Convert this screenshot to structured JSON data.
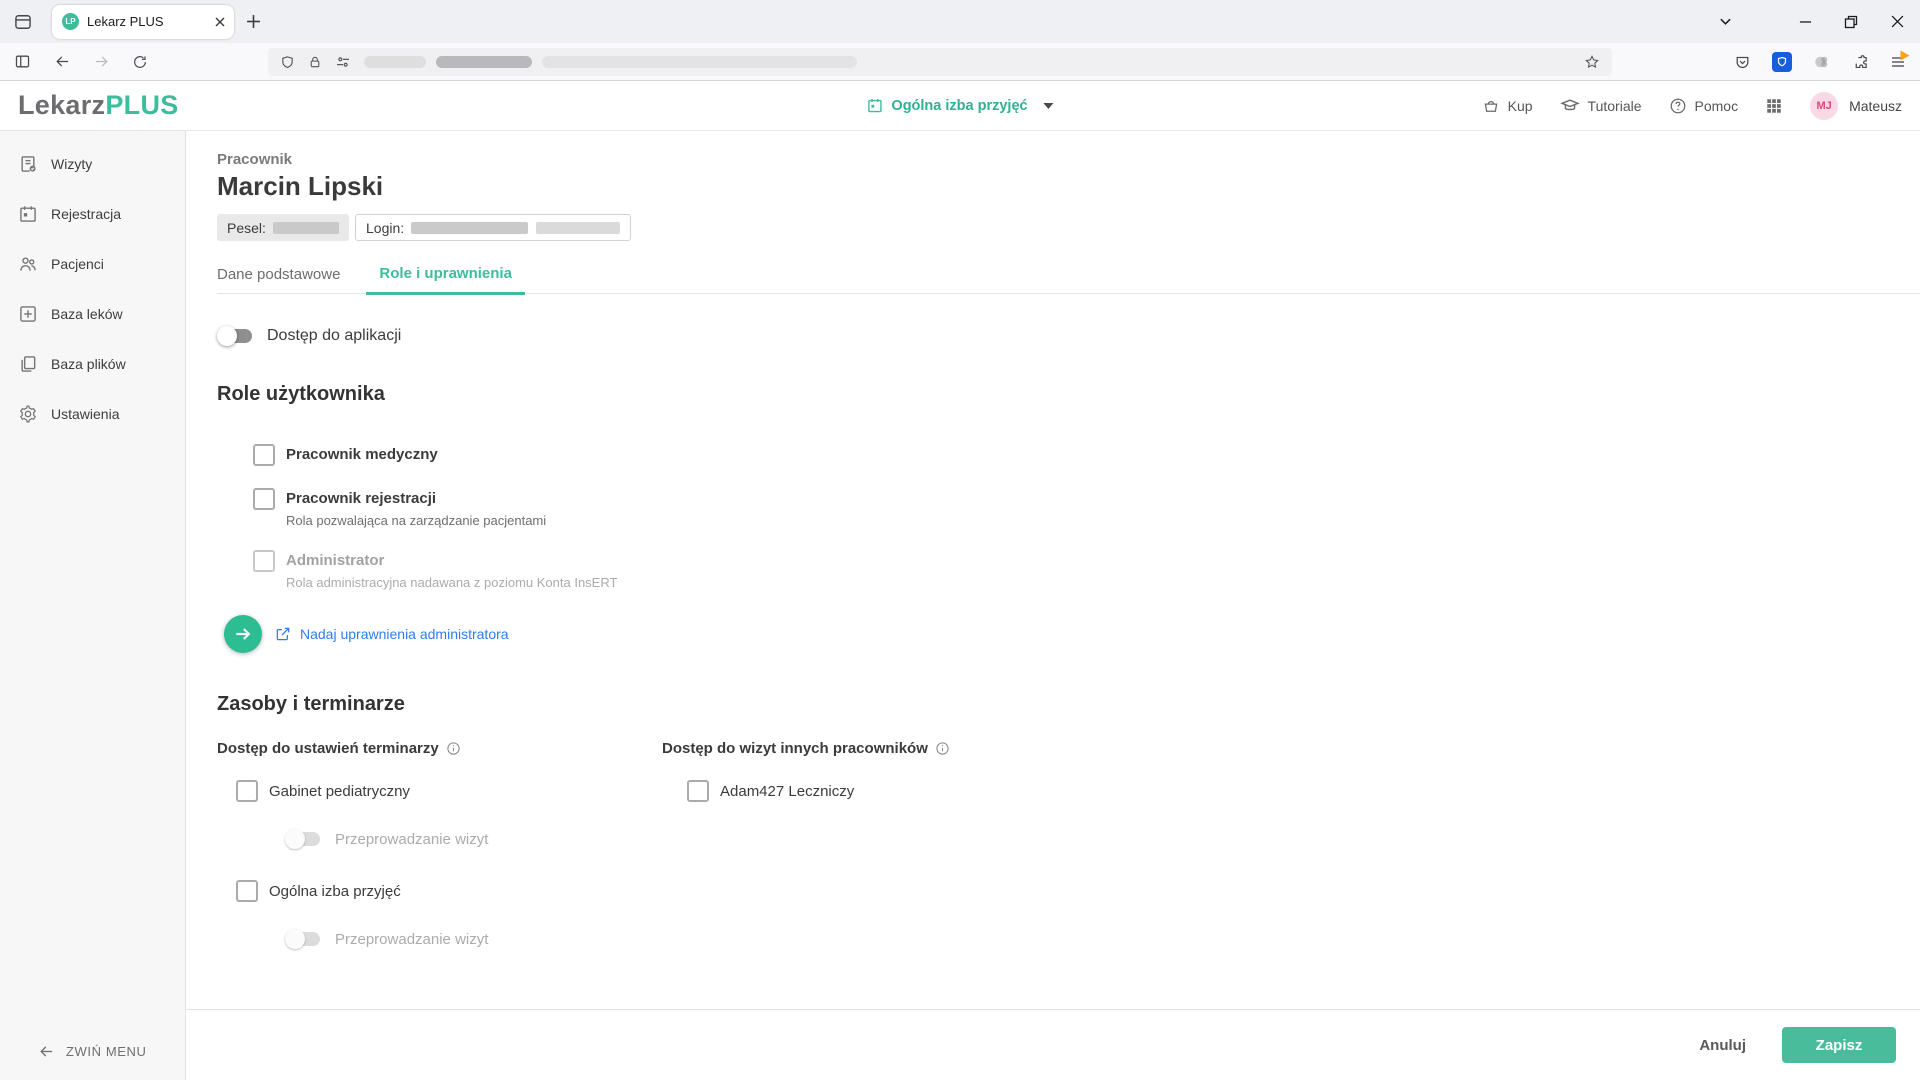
{
  "browser": {
    "tab_title": "Lekarz PLUS",
    "favicon_initials": "LP",
    "url_redacted": true
  },
  "header": {
    "logo_primary": "Lekarz",
    "logo_accent": "PLUS",
    "context_label": "Ogólna izba przyjęć",
    "nav_items": [
      {
        "label": "Kup"
      },
      {
        "label": "Tutoriale"
      },
      {
        "label": "Pomoc"
      }
    ],
    "user_initials": "MJ",
    "user_name": "Mateusz"
  },
  "sidebar": {
    "items": [
      {
        "label": "Wizyty"
      },
      {
        "label": "Rejestracja"
      },
      {
        "label": "Pacjenci"
      },
      {
        "label": "Baza leków"
      },
      {
        "label": "Baza plików"
      },
      {
        "label": "Ustawienia"
      }
    ],
    "collapse_label": "ZWIŃ MENU"
  },
  "page": {
    "entity_label": "Pracownik",
    "title": "Marcin Lipski",
    "pesel_label": "Pesel:",
    "login_label": "Login:",
    "tabs": [
      {
        "label": "Dane podstawowe",
        "active": false
      },
      {
        "label": "Role i uprawnienia",
        "active": true
      }
    ],
    "access_toggle_label": "Dostęp do aplikacji",
    "access_toggle_on": false,
    "roles": {
      "title": "Role użytkownika",
      "items": [
        {
          "label": "Pracownik medyczny",
          "description": "",
          "checked": false,
          "disabled": false
        },
        {
          "label": "Pracownik rejestracji",
          "description": "Rola pozwalająca na zarządzanie pacjentami",
          "checked": false,
          "disabled": false
        },
        {
          "label": "Administrator",
          "description": "Rola administracyjna nadawana z poziomu Konta InsERT",
          "checked": false,
          "disabled": true
        }
      ],
      "admin_link": "Nadaj uprawnienia administratora"
    },
    "resources": {
      "title": "Zasoby i terminarze",
      "schedules": {
        "subtitle": "Dostęp do ustawień terminarzy",
        "items": [
          {
            "label": "Gabinet pediatryczny",
            "checked": false,
            "toggle_label": "Przeprowadzanie wizyt",
            "toggle_on": false
          },
          {
            "label": "Ogólna izba przyjęć",
            "checked": false,
            "toggle_label": "Przeprowadzanie wizyt",
            "toggle_on": false
          }
        ]
      },
      "visits": {
        "subtitle": "Dostęp do wizyt innych pracowników",
        "items": [
          {
            "label": "Adam427 Leczniczy",
            "checked": false
          }
        ]
      }
    },
    "footer": {
      "cancel": "Anuluj",
      "save": "Zapisz"
    }
  },
  "colors": {
    "accent_green": "#3dbd9b",
    "link_blue": "#2e7cf5",
    "save_button": "#49bd9b",
    "avatar_bg": "#f9d9e6",
    "avatar_text": "#e2447e"
  }
}
